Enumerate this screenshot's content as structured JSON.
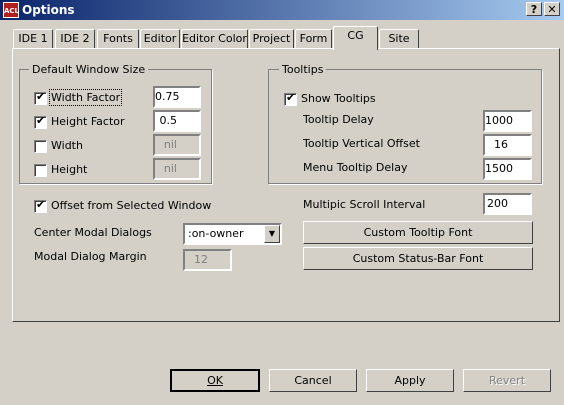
{
  "window": {
    "title": "Options",
    "app_icon_text": "ACL",
    "help_label": "?",
    "close_label": "✕"
  },
  "tabs": [
    {
      "label": "IDE 1"
    },
    {
      "label": "IDE 2"
    },
    {
      "label": "Fonts"
    },
    {
      "label": "Editor"
    },
    {
      "label": "Editor Color"
    },
    {
      "label": "Project"
    },
    {
      "label": "Form"
    },
    {
      "label": "CG"
    },
    {
      "label": "Site"
    }
  ],
  "active_tab": "CG",
  "default_window_size": {
    "title": "Default Window Size",
    "width_factor": {
      "label": "Width Factor",
      "checked": true,
      "value": "0.75"
    },
    "height_factor": {
      "label": "Height Factor",
      "checked": true,
      "value": "0.5"
    },
    "width": {
      "label": "Width",
      "checked": false,
      "value": "nil"
    },
    "height": {
      "label": "Height",
      "checked": false,
      "value": "nil"
    }
  },
  "tooltips": {
    "title": "Tooltips",
    "show_tooltips": {
      "label": "Show Tooltips",
      "checked": true
    },
    "tooltip_delay": {
      "label": "Tooltip Delay",
      "value": "1000"
    },
    "vertical_offset": {
      "label": "Tooltip Vertical Offset",
      "value": "16"
    },
    "menu_delay": {
      "label": "Menu Tooltip Delay",
      "value": "1500"
    }
  },
  "offset_from_selected": {
    "label": "Offset from Selected Window",
    "checked": true
  },
  "center_modal": {
    "label": "Center Modal Dialogs",
    "value": ":on-owner"
  },
  "modal_margin": {
    "label": "Modal Dialog Margin",
    "value": "12"
  },
  "multipic": {
    "label": "Multipic Scroll Interval",
    "value": "200"
  },
  "buttons": {
    "custom_tooltip_font": "Custom Tooltip Font",
    "custom_status_font": "Custom Status-Bar Font",
    "ok": "OK",
    "cancel": "Cancel",
    "apply": "Apply",
    "revert": "Revert"
  },
  "check_mark": "✔",
  "combo_arrow": "▼",
  "colors": {
    "titlebar_start": "#0a246a",
    "titlebar_end": "#a6caf0",
    "face": "#d4d0c8",
    "app_icon": "#b0201c"
  }
}
